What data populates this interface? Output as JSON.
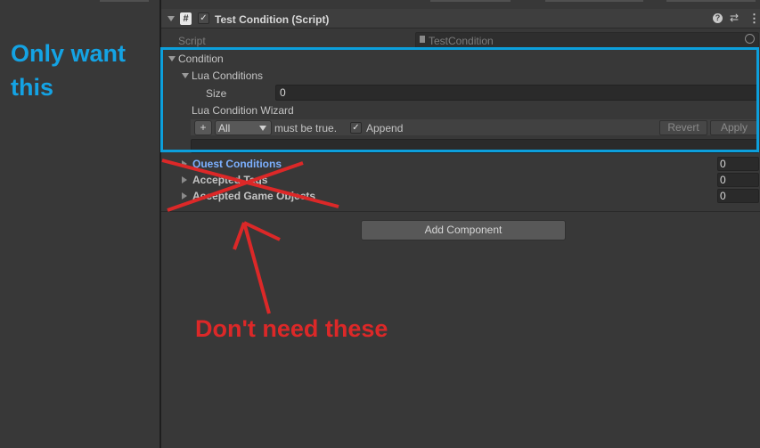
{
  "header": {
    "title": "Test Condition (Script)"
  },
  "script_row": {
    "label": "Script",
    "value": "TestCondition"
  },
  "condition": {
    "label": "Condition",
    "lua_conditions": {
      "label": "Lua Conditions",
      "size_label": "Size",
      "size_value": "0"
    },
    "wizard": {
      "label": "Lua Condition Wizard",
      "add_label": "+",
      "mode_value": "All",
      "must_be_true": "must be true.",
      "append_label": "Append",
      "append_checked": true,
      "revert_label": "Revert",
      "apply_label": "Apply"
    }
  },
  "collapsed_rows": [
    {
      "label": "Quest Conditions",
      "value": "0"
    },
    {
      "label": "Accepted Tags",
      "value": "0"
    },
    {
      "label": "Accepted Game Objects",
      "value": "0"
    }
  ],
  "add_component_label": "Add Component",
  "annotations": {
    "only_want_line1": "Only want",
    "only_want_line2": "this",
    "dont_need": "Don't need these"
  },
  "colors": {
    "highlight": "#0c9fdc",
    "annotation_red": "#dc2828",
    "annotation_blue": "#14a3e4",
    "quest_link": "#7cb0ff"
  }
}
